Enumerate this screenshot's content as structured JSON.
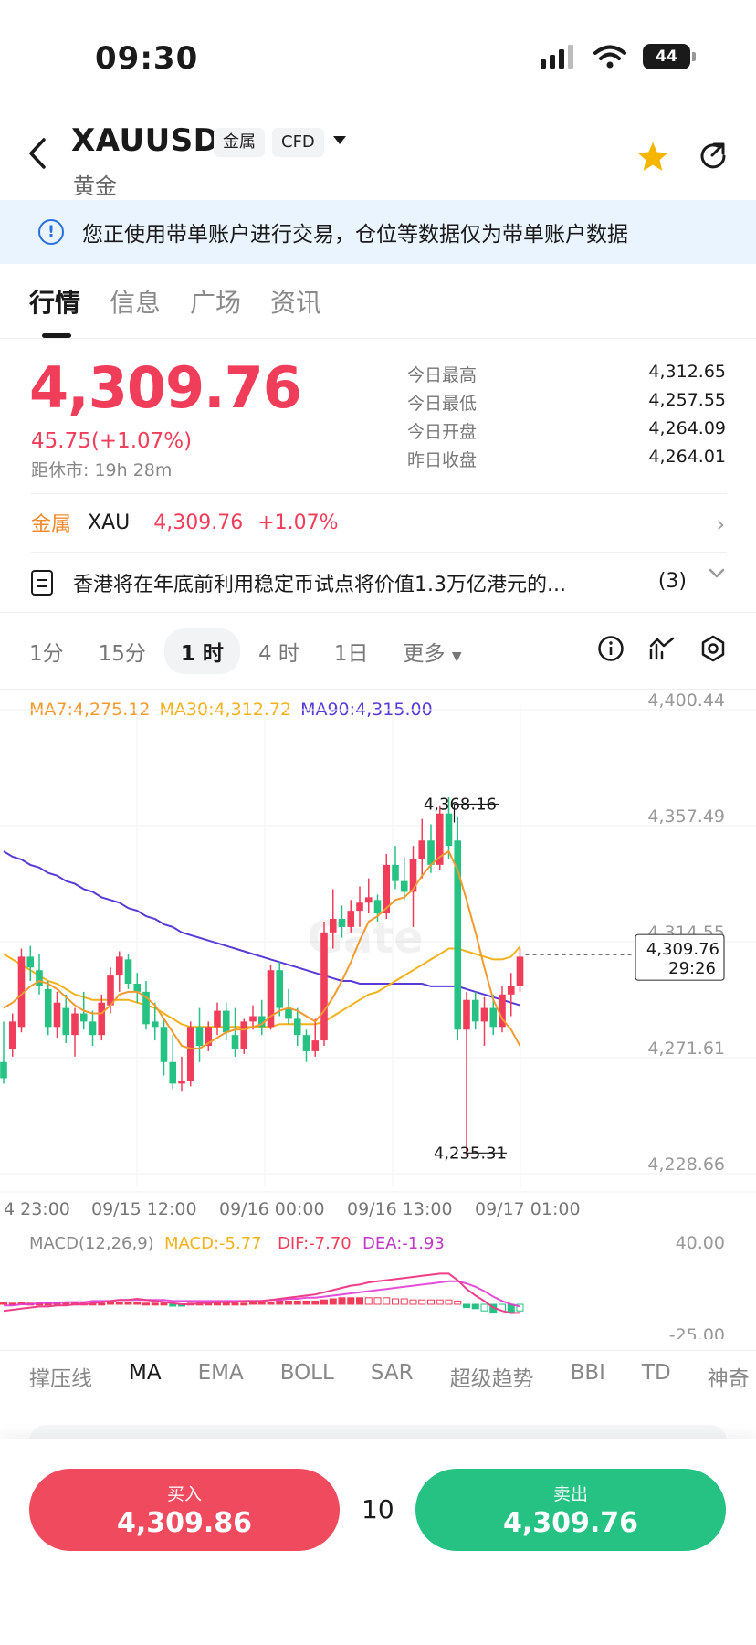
{
  "status": {
    "time": "09:30",
    "battery": "44"
  },
  "header": {
    "symbol": "XAUUSD",
    "tag_category": "金属",
    "tag_type": "CFD",
    "name": "黄金"
  },
  "notice": "您正使用带单账户进行交易，仓位等数据仅为带单账户数据",
  "tabs": [
    "行情",
    "信息",
    "广场",
    "资讯"
  ],
  "price": {
    "last": "4,309.76",
    "change": "45.75(+1.07%)",
    "close_in": "距休市: 19h 28m"
  },
  "stats": [
    {
      "label": "今日最高",
      "value": "4,312.65"
    },
    {
      "label": "今日最低",
      "value": "4,257.55"
    },
    {
      "label": "今日开盘",
      "value": "4,264.09"
    },
    {
      "label": "昨日收盘",
      "value": "4,264.01"
    }
  ],
  "metal_row": {
    "category": "金属",
    "code": "XAU",
    "price": "4,309.76",
    "change": "+1.07%"
  },
  "news": {
    "headline": "香港将在年底前利用稳定币试点将价值1.3万亿港元的...",
    "count": "(3)"
  },
  "timeframes": [
    "1分",
    "15分",
    "1 时",
    "4 时",
    "1日",
    "更多"
  ],
  "timeframe_selected": "1 时",
  "ma_legend": {
    "ma7": "MA7:4,275.12",
    "ma30": "MA30:4,312.72",
    "ma90": "MA90:4,315.00"
  },
  "macd_legend": {
    "title": "MACD(12,26,9)",
    "macd": "MACD:-5.77",
    "dif": "DIF:-7.70",
    "dea": "DEA:-1.93"
  },
  "indicator_tabs": [
    "撑压线",
    "MA",
    "EMA",
    "BOLL",
    "SAR",
    "超级趋势",
    "BBI",
    "TD",
    "神奇"
  ],
  "indicator_selected": "MA",
  "trade": {
    "buy_label": "买入",
    "buy_price": "4,309.86",
    "sell_label": "卖出",
    "sell_price": "4,309.76",
    "quantity": "10"
  },
  "colors": {
    "up": "#f03d5a",
    "down": "#25c283",
    "ma7": "#f29a2e",
    "ma30": "#f3b21b",
    "ma90": "#5a3ad6",
    "dif": "#e23bd1"
  },
  "chart_data": {
    "type": "candlestick",
    "y_axis_labels": [
      "4,400.44",
      "4,357.49",
      "4,314.55",
      "4,271.61",
      "4,228.66"
    ],
    "ylim": [
      4228.66,
      4400.44
    ],
    "x_axis_labels": [
      "4 23:00",
      "09/15 12:00",
      "09/16 00:00",
      "09/16 13:00",
      "09/17 01:00"
    ],
    "high_marker": "4,368.16",
    "low_marker": "4,235.31",
    "current_price": "4,309.76",
    "countdown": "29:26",
    "watermark": "Gate",
    "macd_axis": [
      "40.00",
      "-25.00"
    ],
    "candles": [
      [
        4270,
        4285,
        4262,
        4264
      ],
      [
        4275,
        4288,
        4272,
        4285
      ],
      [
        4283,
        4312,
        4281,
        4309
      ],
      [
        4309,
        4313,
        4300,
        4305
      ],
      [
        4304,
        4310,
        4295,
        4298
      ],
      [
        4297,
        4300,
        4280,
        4283
      ],
      [
        4283,
        4296,
        4279,
        4292
      ],
      [
        4290,
        4295,
        4277,
        4280
      ],
      [
        4280,
        4290,
        4272,
        4288
      ],
      [
        4288,
        4296,
        4282,
        4285
      ],
      [
        4285,
        4289,
        4276,
        4280
      ],
      [
        4280,
        4295,
        4278,
        4292
      ],
      [
        4291,
        4305,
        4288,
        4302
      ],
      [
        4302,
        4311,
        4296,
        4309
      ],
      [
        4308,
        4310,
        4297,
        4299
      ],
      [
        4299,
        4303,
        4292,
        4296
      ],
      [
        4296,
        4300,
        4282,
        4284
      ],
      [
        4285,
        4292,
        4278,
        4283
      ],
      [
        4283,
        4286,
        4265,
        4270
      ],
      [
        4270,
        4280,
        4260,
        4262
      ],
      [
        4262,
        4272,
        4259,
        4263
      ],
      [
        4263,
        4285,
        4261,
        4283
      ],
      [
        4283,
        4290,
        4270,
        4276
      ],
      [
        4276,
        4285,
        4274,
        4283
      ],
      [
        4283,
        4292,
        4280,
        4289
      ],
      [
        4289,
        4292,
        4278,
        4281
      ],
      [
        4280,
        4290,
        4272,
        4275
      ],
      [
        4275,
        4286,
        4273,
        4285
      ],
      [
        4285,
        4291,
        4282,
        4287
      ],
      [
        4287,
        4293,
        4280,
        4283
      ],
      [
        4283,
        4306,
        4282,
        4304
      ],
      [
        4304,
        4307,
        4287,
        4290
      ],
      [
        4290,
        4297,
        4284,
        4286
      ],
      [
        4286,
        4290,
        4276,
        4280
      ],
      [
        4280,
        4282,
        4270,
        4274
      ],
      [
        4274,
        4286,
        4272,
        4278
      ],
      [
        4278,
        4322,
        4276,
        4318
      ],
      [
        4318,
        4334,
        4312,
        4323
      ],
      [
        4323,
        4328,
        4316,
        4320
      ],
      [
        4320,
        4330,
        4318,
        4326
      ],
      [
        4326,
        4335,
        4320,
        4329
      ],
      [
        4329,
        4338,
        4325,
        4331
      ],
      [
        4330,
        4332,
        4322,
        4325
      ],
      [
        4325,
        4347,
        4323,
        4343
      ],
      [
        4343,
        4350,
        4334,
        4337
      ],
      [
        4337,
        4346,
        4330,
        4333
      ],
      [
        4333,
        4350,
        4320,
        4345
      ],
      [
        4345,
        4360,
        4338,
        4352
      ],
      [
        4352,
        4358,
        4340,
        4343
      ],
      [
        4343,
        4365,
        4341,
        4362
      ],
      [
        4362,
        4368,
        4345,
        4350
      ],
      [
        4352,
        4361,
        4278,
        4282
      ],
      [
        4282,
        4296,
        4235,
        4293
      ],
      [
        4293,
        4296,
        4282,
        4285
      ],
      [
        4285,
        4294,
        4276,
        4290
      ],
      [
        4290,
        4295,
        4280,
        4283
      ],
      [
        4283,
        4298,
        4281,
        4295
      ],
      [
        4295,
        4303,
        4287,
        4298
      ],
      [
        4298,
        4312,
        4296,
        4309
      ]
    ],
    "ma7": [
      4290,
      4292,
      4295,
      4298,
      4300,
      4299,
      4297,
      4294,
      4291,
      4289,
      4288,
      4288,
      4291,
      4295,
      4296,
      4296,
      4294,
      4291,
      4286,
      4281,
      4276,
      4275,
      4275,
      4277,
      4279,
      4281,
      4282,
      4282,
      4283,
      4284,
      4287,
      4289,
      4290,
      4289,
      4287,
      4285,
      4289,
      4294,
      4300,
      4307,
      4315,
      4322,
      4324,
      4327,
      4330,
      4331,
      4334,
      4339,
      4343,
      4346,
      4348,
      4341,
      4330,
      4318,
      4305,
      4293,
      4286,
      4282,
      4276
    ],
    "ma30": [
      4310,
      4308,
      4306,
      4304,
      4302,
      4300,
      4299,
      4297,
      4295,
      4294,
      4293,
      4293,
      4293,
      4293,
      4293,
      4292,
      4291,
      4290,
      4288,
      4286,
      4284,
      4283,
      4283,
      4283,
      4283,
      4283,
      4283,
      4283,
      4283,
      4283,
      4283,
      4284,
      4284,
      4284,
      4284,
      4284,
      4285,
      4287,
      4289,
      4291,
      4293,
      4295,
      4296,
      4298,
      4300,
      4302,
      4304,
      4306,
      4308,
      4310,
      4312,
      4312,
      4311,
      4310,
      4309,
      4308,
      4308,
      4309,
      4312.72
    ],
    "ma90": [
      4348,
      4346,
      4345,
      4343,
      4342,
      4340,
      4339,
      4337,
      4336,
      4334,
      4333,
      4331,
      4330,
      4329,
      4327,
      4326,
      4324,
      4323,
      4321,
      4320,
      4318,
      4317,
      4316,
      4315,
      4314,
      4313,
      4312,
      4311,
      4310,
      4309,
      4308,
      4307,
      4306,
      4305,
      4304,
      4303,
      4302,
      4301,
      4300,
      4300,
      4299,
      4299,
      4299,
      4299,
      4299,
      4299,
      4299,
      4299,
      4298,
      4298,
      4298,
      4298,
      4297,
      4296,
      4295,
      4294,
      4293,
      4292,
      4291
    ],
    "macd_hist": [
      2,
      1,
      2,
      1,
      1,
      1,
      2,
      1,
      1,
      1,
      1,
      1,
      2,
      2,
      2,
      2,
      1,
      1,
      1,
      -1,
      -1,
      1,
      1,
      1,
      1,
      1,
      1,
      1,
      2,
      2,
      2,
      3,
      3,
      3,
      3,
      3,
      4,
      5,
      6,
      6,
      6,
      6,
      6,
      6,
      5,
      5,
      4,
      4,
      4,
      4,
      4,
      3,
      -3,
      -4,
      -6,
      -8,
      -8,
      -7,
      -6
    ],
    "dif": [
      -6,
      -5,
      -4,
      -3,
      -2,
      -2,
      -1,
      -1,
      0,
      0,
      1,
      2,
      3,
      4,
      4,
      5,
      4,
      3,
      2,
      1,
      0,
      0,
      1,
      1,
      2,
      2,
      2,
      3,
      3,
      3,
      4,
      5,
      6,
      7,
      8,
      9,
      11,
      13,
      15,
      17,
      18,
      20,
      21,
      22,
      23,
      24,
      25,
      26,
      27,
      28,
      28,
      22,
      14,
      8,
      3,
      -3,
      -6,
      -8,
      -7.7
    ],
    "dea": [
      -1,
      -1,
      0,
      0,
      1,
      1,
      1,
      2,
      2,
      2,
      3,
      3,
      3,
      4,
      4,
      4,
      4,
      4,
      4,
      3,
      3,
      3,
      3,
      3,
      3,
      3,
      3,
      3,
      3,
      3,
      4,
      4,
      5,
      5,
      6,
      6,
      7,
      8,
      9,
      10,
      11,
      12,
      13,
      14,
      15,
      16,
      17,
      18,
      19,
      20,
      21,
      21,
      19,
      16,
      12,
      7,
      3,
      0,
      -1.93
    ]
  }
}
